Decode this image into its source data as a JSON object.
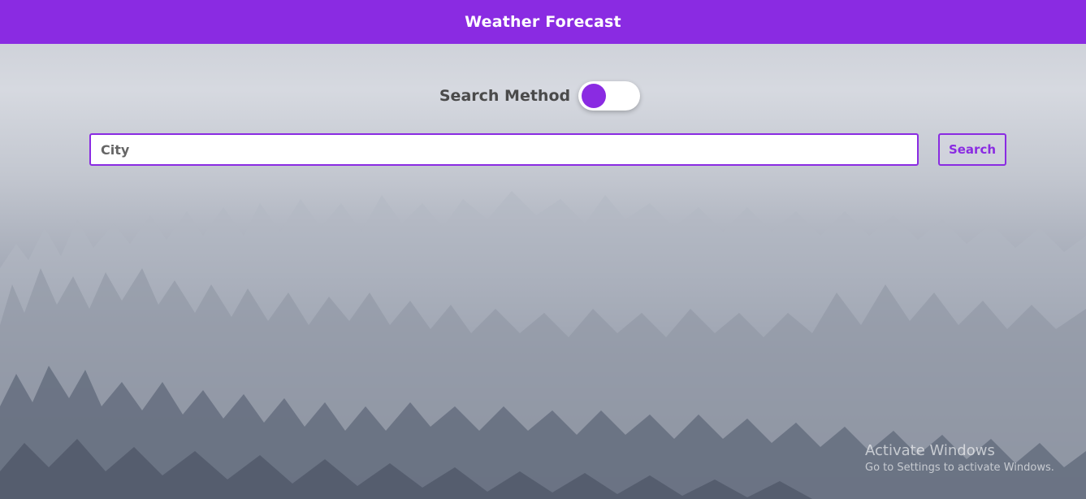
{
  "header": {
    "title": "Weather Forecast"
  },
  "search_method": {
    "label": "Search Method",
    "toggle_on": false
  },
  "search": {
    "placeholder": "City",
    "value": "",
    "button_label": "Search"
  },
  "watermark": {
    "title": "Activate Windows",
    "subtitle": "Go to Settings to activate Windows."
  },
  "colors": {
    "accent": "#8a2be2",
    "header_text": "#ffffff",
    "label_text": "#4a4a4a"
  }
}
